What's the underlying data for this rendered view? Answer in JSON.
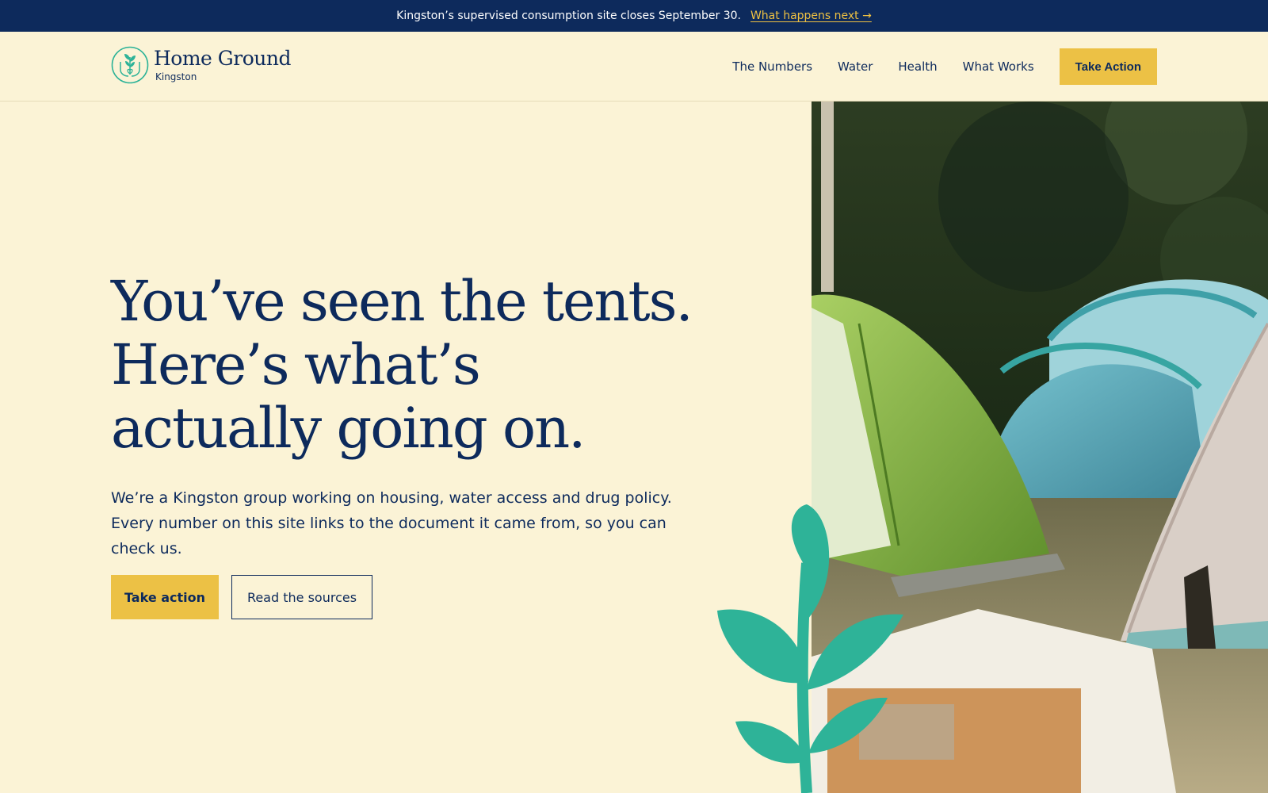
{
  "announcement": {
    "message": "Kingston’s supervised consumption site closes September 30.",
    "link": "What happens next →"
  },
  "brand": {
    "name": "Home Ground",
    "location": "Kingston"
  },
  "nav": {
    "items": [
      "The Numbers",
      "Water",
      "Health",
      "What Works"
    ],
    "cta": "Take Action"
  },
  "hero": {
    "headline": [
      "You’ve seen the tents.",
      "Here’s what’s",
      "actually going on."
    ],
    "lede": [
      "We’re a Kingston group working on housing, water access and drug policy.",
      "Every number on this site links to the document it came from, so you can check us."
    ],
    "primary_cta": "Take action",
    "secondary_cta": "Read the sources"
  },
  "colors": {
    "background": "#fbf3d6",
    "navy": "#0d2a5c",
    "accent_yellow": "#ecc145",
    "leaf_green": "#2eb398"
  },
  "icons": {
    "logo": "hands-holding-plant-icon",
    "decoration": "sprout-leaf-icon"
  }
}
